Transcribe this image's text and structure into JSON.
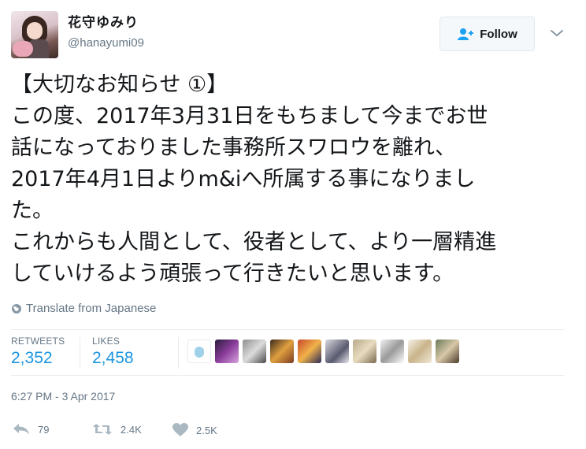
{
  "user": {
    "display_name": "花守ゆみり",
    "handle": "@hanayumi09"
  },
  "follow_button": {
    "label": "Follow"
  },
  "tweet": {
    "lines": [
      "【大切なお知らせ ①】",
      "この度、2017年3月31日をもちまして今までお世",
      "話になっておりました事務所スワロウを離れ、",
      "2017年4月1日よりm&iへ所属する事になりまし",
      "た。",
      "これからも人間として、役者として、より一層精進",
      "していけるよう頑張って行きたいと思います。"
    ]
  },
  "translate": {
    "label": "Translate from Japanese"
  },
  "stats": {
    "retweets_label": "RETWEETS",
    "retweets_count": "2,352",
    "likes_label": "LIKES",
    "likes_count": "2,458"
  },
  "timestamp": "6:27 PM - 3 Apr 2017",
  "actions": {
    "reply_count": "79",
    "retweet_count": "2.4K",
    "like_count": "2.5K"
  },
  "colors": {
    "link": "#1b95e0",
    "muted": "#657786",
    "text": "#14171a"
  },
  "icons": [
    "add-user-icon",
    "chevron-down-icon",
    "globe-icon",
    "reply-icon",
    "retweet-icon",
    "heart-icon"
  ]
}
